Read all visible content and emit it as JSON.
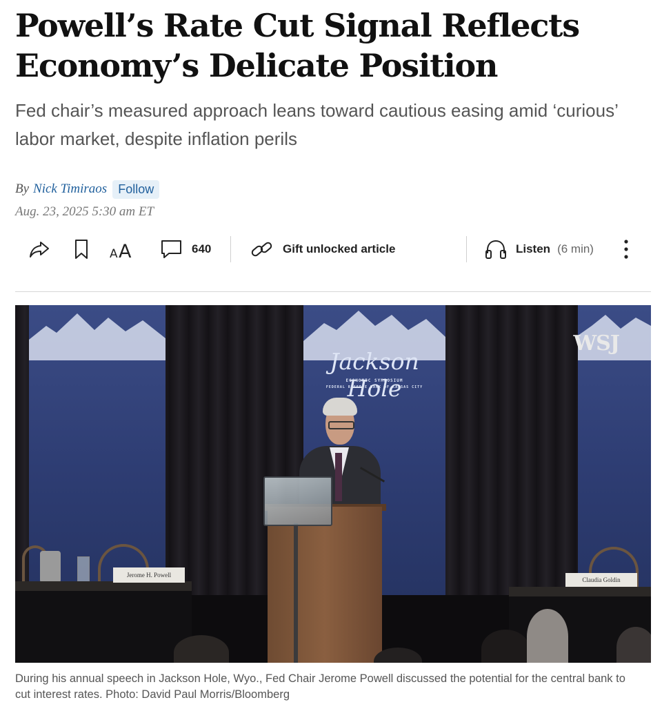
{
  "article": {
    "headline": "Powell’s Rate Cut Signal Reflects Economy’s Delicate Position",
    "dek": "Fed chair’s measured approach leans toward cautious easing amid ‘curious’ labor market, despite inflation perils",
    "byline_prefix": "By",
    "author": "Nick Timiraos",
    "follow_label": "Follow",
    "date": "Aug. 23, 2025 5:30 am ET"
  },
  "toolbar": {
    "share_icon": "share-icon",
    "bookmark_icon": "bookmark-icon",
    "text_size_icon": "text-size-icon",
    "comment_icon": "comment-icon",
    "comment_count": "640",
    "gift_icon": "link-icon",
    "gift_label": "Gift unlocked article",
    "listen_icon": "headphones-icon",
    "listen_label": "Listen",
    "listen_duration": "(6 min)",
    "more_icon": "more-vertical-icon"
  },
  "photo": {
    "banner_title": "Jackson Hole",
    "banner_line1": "ECONOMIC SYMPOSIUM",
    "banner_line2": "FEDERAL RESERVE BANK OF KANSAS CITY",
    "watermark": "WSJ",
    "nameplate_left": "Jerome H. Powell",
    "nameplate_right": "Claudia Goldin",
    "caption": "During his annual speech in Jackson Hole, Wyo., Fed Chair Jerome Powell discussed the potential for the central bank to cut interest rates. Photo: David Paul Morris/Bloomberg"
  },
  "colors": {
    "link": "#1f5f9c",
    "follow_bg": "#e6f0f8",
    "banner": "#33447b"
  }
}
